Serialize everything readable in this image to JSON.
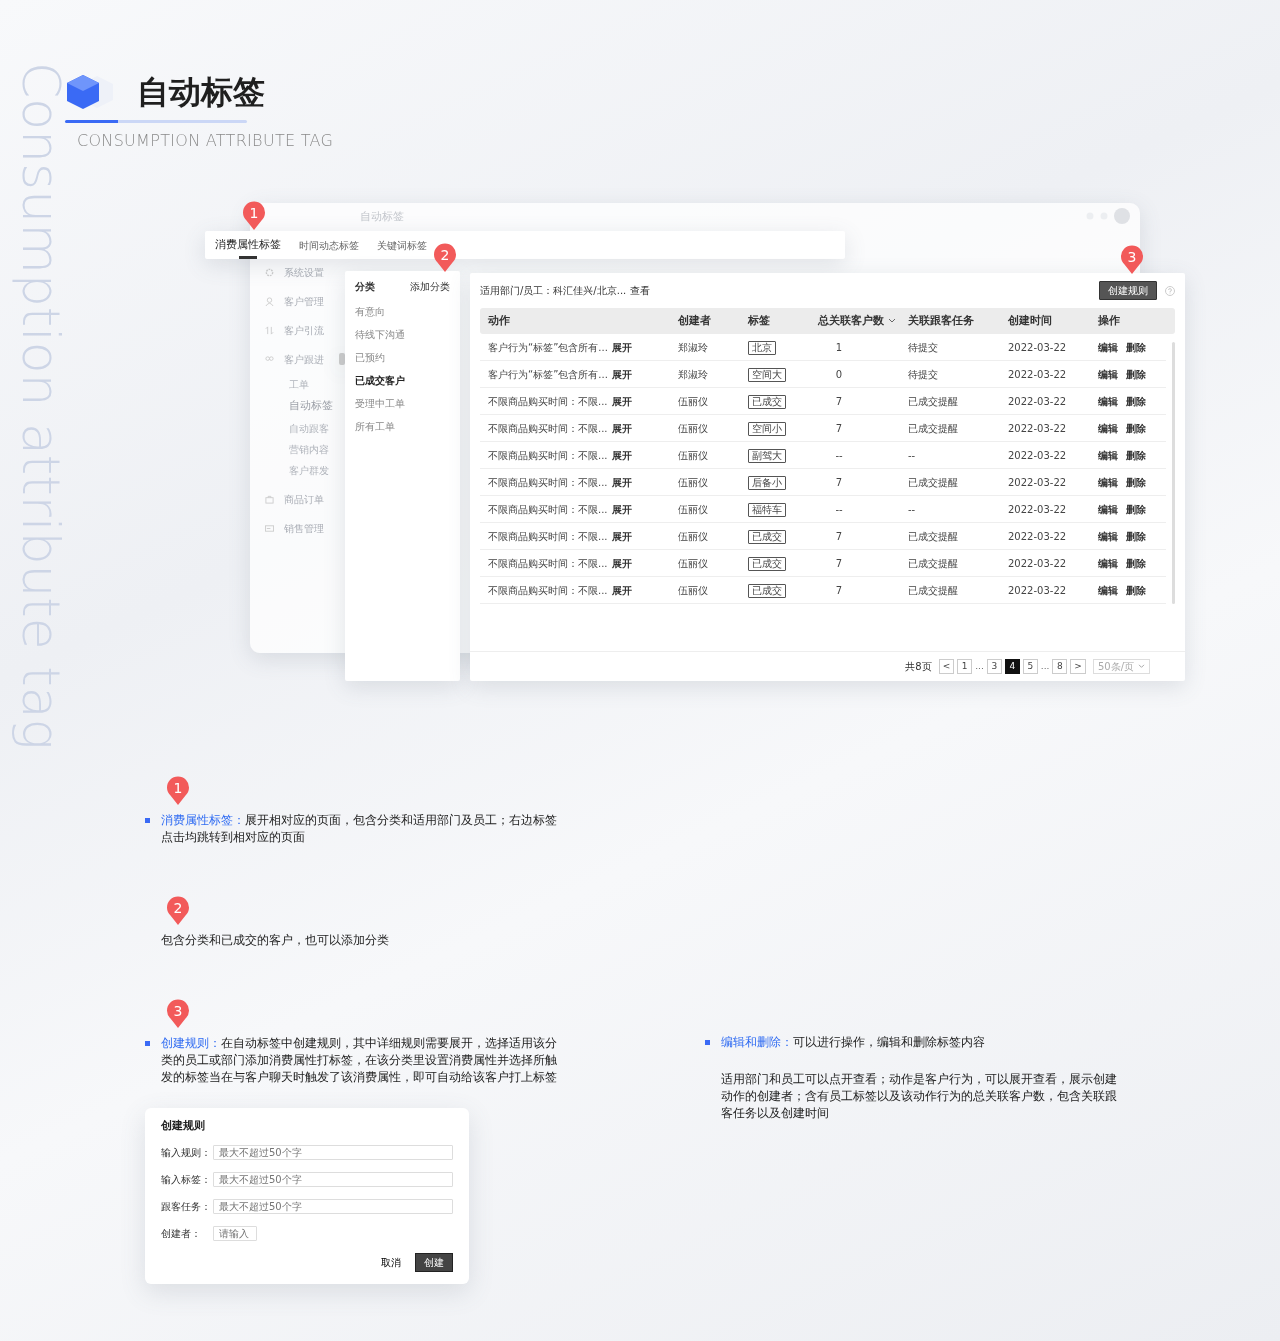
{
  "header": {
    "title": "自动标签",
    "subtitle": "CONSUMPTION ATTRIBUTE TAG",
    "side_text": "Consumption attribute tag"
  },
  "mockup": {
    "window_title": "自动标签",
    "markers": [
      "1",
      "2",
      "3"
    ],
    "tabs": [
      {
        "label": "消费属性标签",
        "selected": true
      },
      {
        "label": "时间动态标签",
        "selected": false
      },
      {
        "label": "关键词标签",
        "selected": false
      }
    ],
    "sidebar": [
      {
        "label": "系统设置"
      },
      {
        "label": "客户管理"
      },
      {
        "label": "客户引流"
      },
      {
        "label": "客户跟进",
        "children": [
          {
            "label": "工单",
            "selected": false
          },
          {
            "label": "自动标签",
            "selected": true
          },
          {
            "label": "自动跟客",
            "selected": false
          },
          {
            "label": "营销内容",
            "selected": false
          },
          {
            "label": "客户群发",
            "selected": false
          }
        ]
      },
      {
        "label": "商品订单"
      },
      {
        "label": "销售管理"
      }
    ],
    "categories": {
      "title": "分类",
      "add": "添加分类",
      "items": [
        {
          "label": "有意向",
          "selected": false
        },
        {
          "label": "待线下沟通",
          "selected": false
        },
        {
          "label": "已预约",
          "selected": false
        },
        {
          "label": "已成交客户",
          "selected": true
        },
        {
          "label": "受理中工单",
          "selected": false
        },
        {
          "label": "所有工单",
          "selected": false
        }
      ]
    },
    "table": {
      "scope_label": "适用部门/员工：科汇佳兴/北京...",
      "scope_link": "查看",
      "create_button": "创建规则",
      "columns": [
        "动作",
        "创建者",
        "标签",
        "总关联客户数",
        "关联跟客任务",
        "创建时间",
        "操作"
      ],
      "rows": [
        {
          "action": "客户行为“标签”包含所有...",
          "expand": "展开",
          "creator": "郑淑玲",
          "tag": "北京",
          "customers": "1",
          "task": "待提交",
          "created": "2022-03-22",
          "ops": [
            "编辑",
            "删除"
          ]
        },
        {
          "action": "客户行为“标签”包含所有...",
          "expand": "展开",
          "creator": "郑淑玲",
          "tag": "空间大",
          "customers": "0",
          "task": "待提交",
          "created": "2022-03-22",
          "ops": [
            "编辑",
            "删除"
          ]
        },
        {
          "action": "不限商品购买时间：不限...",
          "expand": "展开",
          "creator": "伍丽仪",
          "tag": "已成交",
          "customers": "7",
          "task": "已成交提醒",
          "created": "2022-03-22",
          "ops": [
            "编辑",
            "删除"
          ]
        },
        {
          "action": "不限商品购买时间：不限...",
          "expand": "展开",
          "creator": "伍丽仪",
          "tag": "空间小",
          "customers": "7",
          "task": "已成交提醒",
          "created": "2022-03-22",
          "ops": [
            "编辑",
            "删除"
          ]
        },
        {
          "action": "不限商品购买时间：不限...",
          "expand": "展开",
          "creator": "伍丽仪",
          "tag": "副驾大",
          "customers": "--",
          "task": "--",
          "created": "2022-03-22",
          "ops": [
            "编辑",
            "删除"
          ]
        },
        {
          "action": "不限商品购买时间：不限...",
          "expand": "展开",
          "creator": "伍丽仪",
          "tag": "后备小",
          "customers": "7",
          "task": "已成交提醒",
          "created": "2022-03-22",
          "ops": [
            "编辑",
            "删除"
          ]
        },
        {
          "action": "不限商品购买时间：不限...",
          "expand": "展开",
          "creator": "伍丽仪",
          "tag": "福特车",
          "customers": "--",
          "task": "--",
          "created": "2022-03-22",
          "ops": [
            "编辑",
            "删除"
          ]
        },
        {
          "action": "不限商品购买时间：不限...",
          "expand": "展开",
          "creator": "伍丽仪",
          "tag": "已成交",
          "customers": "7",
          "task": "已成交提醒",
          "created": "2022-03-22",
          "ops": [
            "编辑",
            "删除"
          ]
        },
        {
          "action": "不限商品购买时间：不限...",
          "expand": "展开",
          "creator": "伍丽仪",
          "tag": "已成交",
          "customers": "7",
          "task": "已成交提醒",
          "created": "2022-03-22",
          "ops": [
            "编辑",
            "删除"
          ]
        },
        {
          "action": "不限商品购买时间：不限...",
          "expand": "展开",
          "creator": "伍丽仪",
          "tag": "已成交",
          "customers": "7",
          "task": "已成交提醒",
          "created": "2022-03-22",
          "ops": [
            "编辑",
            "删除"
          ]
        }
      ]
    },
    "pagination": {
      "total": "共8页",
      "prev": "<",
      "next": ">",
      "page_size": "50条/页",
      "pages": [
        {
          "label": "1",
          "selected": false
        },
        {
          "label": "...",
          "selected": false
        },
        {
          "label": "3",
          "selected": false
        },
        {
          "label": "4",
          "selected": true
        },
        {
          "label": "5",
          "selected": false
        },
        {
          "label": "...",
          "selected": false
        },
        {
          "label": "8",
          "selected": false
        }
      ]
    }
  },
  "notes": [
    {
      "marker": "1",
      "bullet": true,
      "lead": "消费属性标签：",
      "text": "展开相对应的页面，包含分类和适用部门及员工；右边标签点击均跳转到相对应的页面"
    },
    {
      "marker": "2",
      "bullet": false,
      "text": "包含分类和已成交的客户，也可以添加分类"
    },
    {
      "marker": "3",
      "bullet": true,
      "lead": "创建规则：",
      "text": "在自动标签中创建规则，其中详细规则需要展开，选择适用该分类的员工或部门添加消费属性打标签，在该分类里设置消费属性并选择所触发的标签当在与客户聊天时触发了该消费属性，即可自动给该客户打上标签"
    }
  ],
  "dialog": {
    "title": "创建规则",
    "fields": [
      {
        "label": "输入规则：",
        "placeholder": "最大不超过50个字",
        "kind": "wide"
      },
      {
        "label": "输入标签：",
        "placeholder": "最大不超过50个字",
        "kind": "wide"
      },
      {
        "label": "跟客任务：",
        "placeholder": "最大不超过50个字",
        "kind": "wide"
      },
      {
        "label": "创建者：",
        "placeholder": "请输入",
        "kind": "short"
      }
    ],
    "buttons": [
      {
        "label": "取消",
        "kind": "text"
      },
      {
        "label": "创建",
        "kind": "primary"
      }
    ]
  },
  "side_note": {
    "bullet": true,
    "lead": "编辑和删除：",
    "text": "可以进行操作，编辑和删除标签内容",
    "detail": "适用部门和员工可以点开查看；动作是客户行为，可以展开查看，展示创建动作的创建者；含有员工标签以及该动作行为的总关联客户数，包含关联跟客任务以及创建时间"
  }
}
